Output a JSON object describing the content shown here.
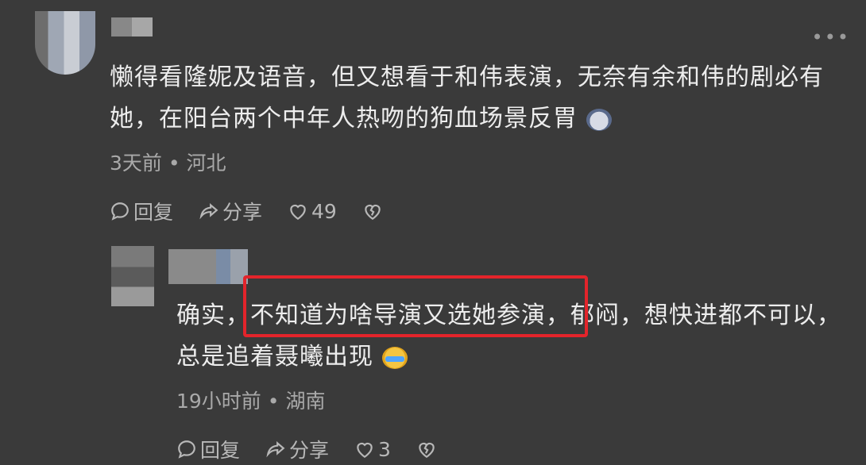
{
  "comment1": {
    "text": "懒得看隆妮及语音，但又想看于和伟表演，无奈有余和伟的剧必有她，在阳台两个中年人热吻的狗血场景反胃",
    "time": "3天前",
    "location": "河北",
    "reply_label": "回复",
    "share_label": "分享",
    "likes": "49",
    "emoji": "sad-face"
  },
  "comment2": {
    "text_before": "确实，",
    "text_highlight": "不知道为啥导演又选她参演",
    "text_after": "，郁闷，想快进都不可以，总是追着聂曦出现",
    "time": "19小时前",
    "location": "湖南",
    "reply_label": "回复",
    "share_label": "分享",
    "likes": "3",
    "emoji": "laugh-cry-face",
    "highlight_color": "#e3242b"
  },
  "separator": " • ",
  "more_glyph": "•••"
}
